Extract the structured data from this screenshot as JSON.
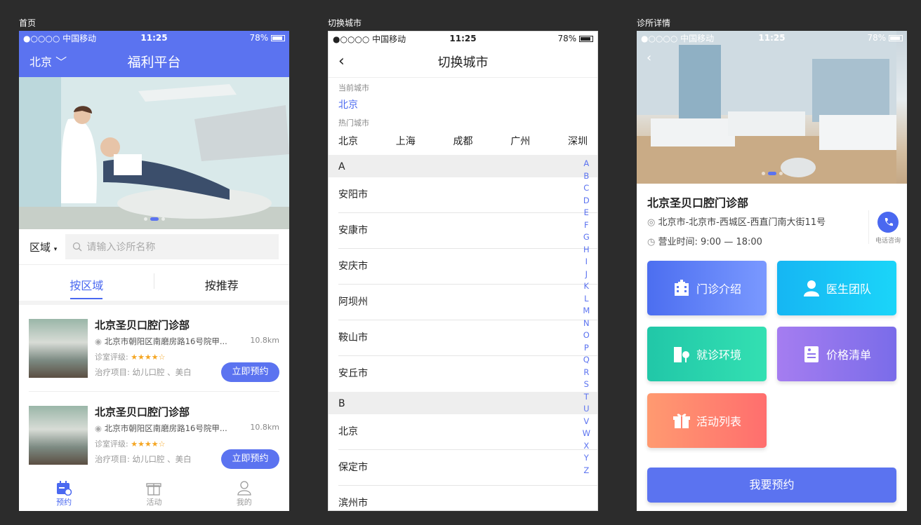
{
  "labels": {
    "home": "首页",
    "switch_city": "切换城市",
    "clinic_detail": "诊所详情"
  },
  "status": {
    "carrier": "●○○○○ 中国移动",
    "time": "11:25",
    "battery": "78%"
  },
  "home": {
    "city": "北京",
    "title": "福利平台",
    "area": "区域",
    "search_placeholder": "请输入诊所名称",
    "tab_area": "按区域",
    "tab_recommend": "按推荐",
    "clinics": [
      {
        "name": "北京圣贝口腔门诊部",
        "address": "北京市朝阳区南磨房路16号院甲...",
        "distance": "10.8km",
        "rating_label": "诊室评级:",
        "stars": "★★★★☆",
        "items": "治疗项目: 幼儿口腔 、美白",
        "book": "立即预约"
      },
      {
        "name": "北京圣贝口腔门诊部",
        "address": "北京市朝阳区南磨房路16号院甲...",
        "distance": "10.8km",
        "rating_label": "诊室评级:",
        "stars": "★★★★☆",
        "items": "治疗项目: 幼儿口腔 、美白",
        "book": "立即预约"
      }
    ],
    "tabbar": [
      {
        "label": "预约"
      },
      {
        "label": "活动"
      },
      {
        "label": "我的"
      }
    ]
  },
  "city": {
    "title": "切换城市",
    "current_label": "当前城市",
    "current": "北京",
    "hot_label": "热门城市",
    "hot": [
      "北京",
      "上海",
      "成都",
      "广州",
      "深圳"
    ],
    "section_a": "A",
    "a_cities": [
      "安阳市",
      "安康市",
      "安庆市",
      "阿坝州",
      "鞍山市",
      "安丘市"
    ],
    "section_b": "B",
    "b_cities": [
      "北京",
      "保定市",
      "滨州市"
    ],
    "index": [
      "A",
      "B",
      "C",
      "D",
      "E",
      "F",
      "G",
      "H",
      "I",
      "J",
      "K",
      "L",
      "M",
      "N",
      "O",
      "P",
      "Q",
      "R",
      "S",
      "T",
      "U",
      "V",
      "W",
      "X",
      "Y",
      "Z"
    ]
  },
  "detail": {
    "name": "北京圣贝口腔门诊部",
    "address": "北京市-北京市-西城区-西直门南大街11号",
    "hours": "营业时间:  9:00 — 18:00",
    "call": "电话咨询",
    "tiles": [
      "门诊介绍",
      "医生团队",
      "就诊环境",
      "价格清单",
      "活动列表"
    ],
    "book": "我要预约"
  }
}
